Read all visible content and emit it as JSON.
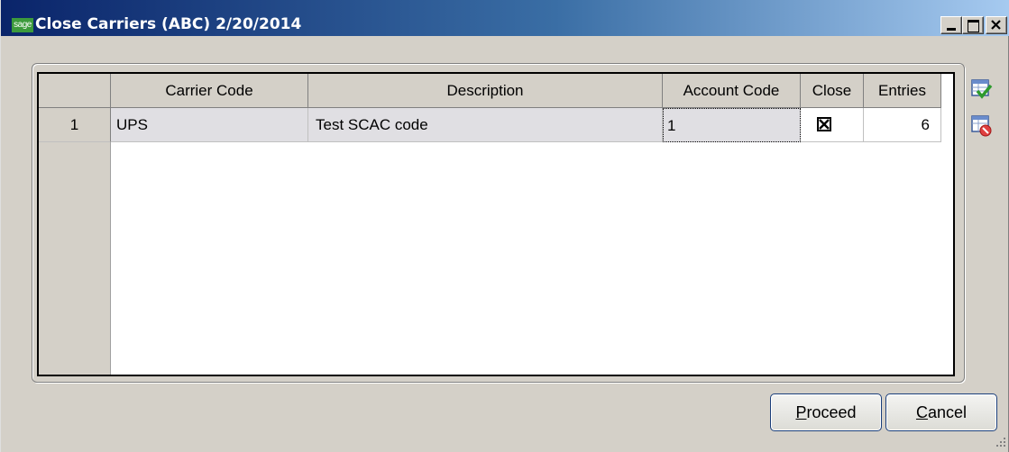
{
  "window": {
    "logo_text": "sage",
    "title": "Close Carriers (ABC) 2/20/2014",
    "caption_buttons": [
      "minimize",
      "maximize",
      "close"
    ]
  },
  "grid": {
    "columns": [
      "Carrier Code",
      "Description",
      "Account Code",
      "Close",
      "Entries"
    ],
    "rows": [
      {
        "row_number": "1",
        "carrier_code": "UPS",
        "description": "Test SCAC code",
        "account_code": "1",
        "close": true,
        "entries": "6"
      }
    ]
  },
  "side_icons": [
    "grid-select-all-icon",
    "grid-clear-icon"
  ],
  "buttons": {
    "proceed_mnemonic": "P",
    "proceed_rest": "roceed",
    "cancel_mnemonic": "C",
    "cancel_rest": "ancel"
  },
  "colors": {
    "title_gradient_start": "#0a246a",
    "title_gradient_end": "#a6caf0",
    "dialog_background": "#d4d0c8",
    "button_border": "#1a3e7a"
  }
}
